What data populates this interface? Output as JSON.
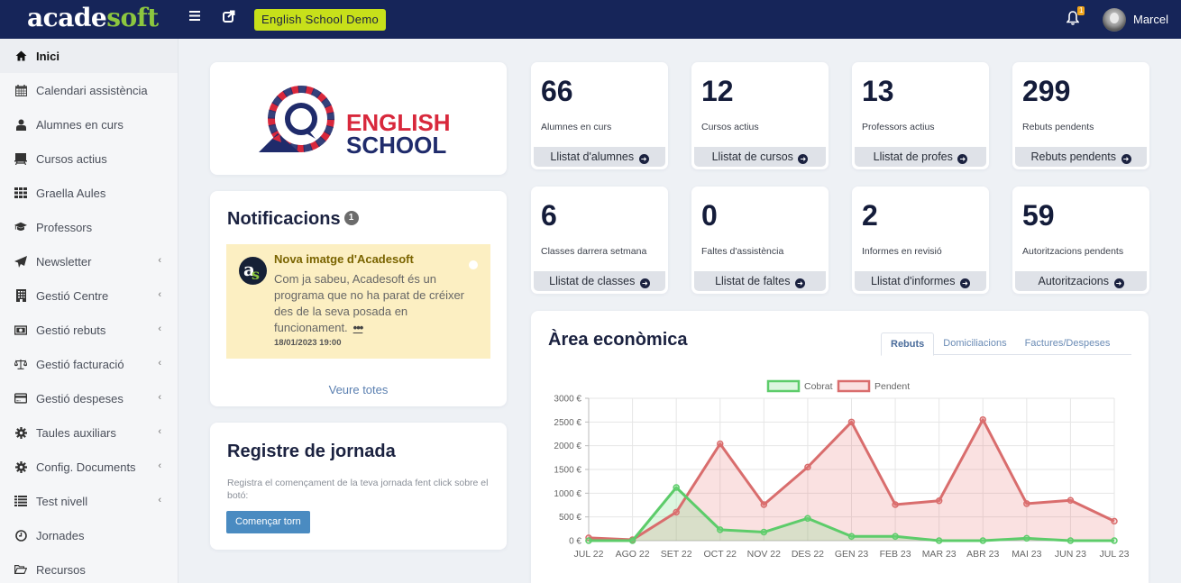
{
  "topbar": {
    "logo_part1": "acade",
    "logo_part2": "soft",
    "demo_label": "English School Demo",
    "notification_count": "1",
    "username": "Marcel"
  },
  "sidebar": {
    "items": [
      {
        "label": "Inici",
        "icon": "home-icon",
        "active": true,
        "submenu": false
      },
      {
        "label": "Calendari assistència",
        "icon": "calendar-icon",
        "submenu": false
      },
      {
        "label": "Alumnes en curs",
        "icon": "user-icon",
        "submenu": false
      },
      {
        "label": "Cursos actius",
        "icon": "presentation-icon",
        "submenu": false
      },
      {
        "label": "Graella Aules",
        "icon": "grid-icon",
        "submenu": false
      },
      {
        "label": "Professors",
        "icon": "graduation-cap-icon",
        "submenu": false
      },
      {
        "label": "Newsletter",
        "icon": "paper-plane-icon",
        "submenu": true
      },
      {
        "label": "Gestió Centre",
        "icon": "building-icon",
        "submenu": true
      },
      {
        "label": "Gestió rebuts",
        "icon": "money-bill-icon",
        "submenu": true
      },
      {
        "label": "Gestió facturació",
        "icon": "balance-scale-icon",
        "submenu": true
      },
      {
        "label": "Gestió despeses",
        "icon": "credit-card-icon",
        "submenu": true
      },
      {
        "label": "Taules auxiliars",
        "icon": "gear-icon",
        "submenu": true
      },
      {
        "label": "Config. Documents",
        "icon": "gear-icon",
        "submenu": true
      },
      {
        "label": "Test nivell",
        "icon": "list-icon",
        "submenu": true
      },
      {
        "label": "Jornades",
        "icon": "clock-icon",
        "submenu": false
      },
      {
        "label": "Recursos",
        "icon": "folder-open-icon",
        "submenu": false
      }
    ]
  },
  "school_logo": {
    "line1": "ENGLISH",
    "line2": "SCHOOL"
  },
  "notifications": {
    "title": "Notificacions",
    "count": "1",
    "items": [
      {
        "title": "Nova imatge d'Acadesoft",
        "body": "Com ja sabeu, Acadesoft és un programa que no ha parat de créixer des de la seva posada en funcionament.",
        "more": "•••",
        "date": "18/01/2023 19:00"
      }
    ],
    "see_all": "Veure totes"
  },
  "registre": {
    "title": "Registre de jornada",
    "text": "Registra el començament de la teva jornada fent click sobre el botó:",
    "button": "Començar torn"
  },
  "stats": [
    {
      "value": "66",
      "label": "Alumnes en curs",
      "link": "Llistat d'alumnes"
    },
    {
      "value": "12",
      "label": "Cursos actius",
      "link": "Llistat de cursos"
    },
    {
      "value": "13",
      "label": "Professors actius",
      "link": "Llistat de profes"
    },
    {
      "value": "299",
      "label": "Rebuts pendents",
      "link": "Rebuts pendents"
    },
    {
      "value": "6",
      "label": "Classes darrera setmana",
      "link": "Llistat de classes"
    },
    {
      "value": "0",
      "label": "Faltes d'assistència",
      "link": "Llistat de faltes"
    },
    {
      "value": "2",
      "label": "Informes en revisió",
      "link": "Llistat d'informes"
    },
    {
      "value": "59",
      "label": "Autoritzacions pendents",
      "link": "Autoritzacions"
    }
  ],
  "econ": {
    "title": "Àrea econòmica",
    "tabs": [
      {
        "label": "Rebuts",
        "active": true
      },
      {
        "label": "Domiciliacions",
        "active": false
      },
      {
        "label": "Factures/Despeses",
        "active": false
      }
    ]
  },
  "chart_data": {
    "type": "line",
    "title": "",
    "xlabel": "",
    "ylabel": "",
    "categories": [
      "JUL 22",
      "AGO 22",
      "SET 22",
      "OCT 22",
      "NOV 22",
      "DES 22",
      "GEN 23",
      "FEB 23",
      "MAR 23",
      "ABR 23",
      "MAI 23",
      "JUN 23",
      "JUL 23"
    ],
    "series": [
      {
        "name": "Cobrat",
        "color": "#5dcc6a",
        "fill": "rgba(120,220,130,0.25)",
        "values": [
          0,
          0,
          1120,
          230,
          180,
          470,
          90,
          90,
          0,
          0,
          50,
          0,
          0
        ]
      },
      {
        "name": "Pendent",
        "color": "#d96d6d",
        "fill": "rgba(230,120,120,0.22)",
        "values": [
          60,
          20,
          600,
          2040,
          760,
          1550,
          2500,
          760,
          840,
          2550,
          780,
          850,
          410
        ]
      }
    ],
    "ylim": [
      0,
      3000
    ],
    "yticks": [
      0,
      500,
      1000,
      1500,
      2000,
      2500,
      3000
    ],
    "ytick_labels": [
      "0 €",
      "500 €",
      "1000 €",
      "1500 €",
      "2000 €",
      "2500 €",
      "3000 €"
    ],
    "grid": true,
    "legend": "top-center"
  }
}
